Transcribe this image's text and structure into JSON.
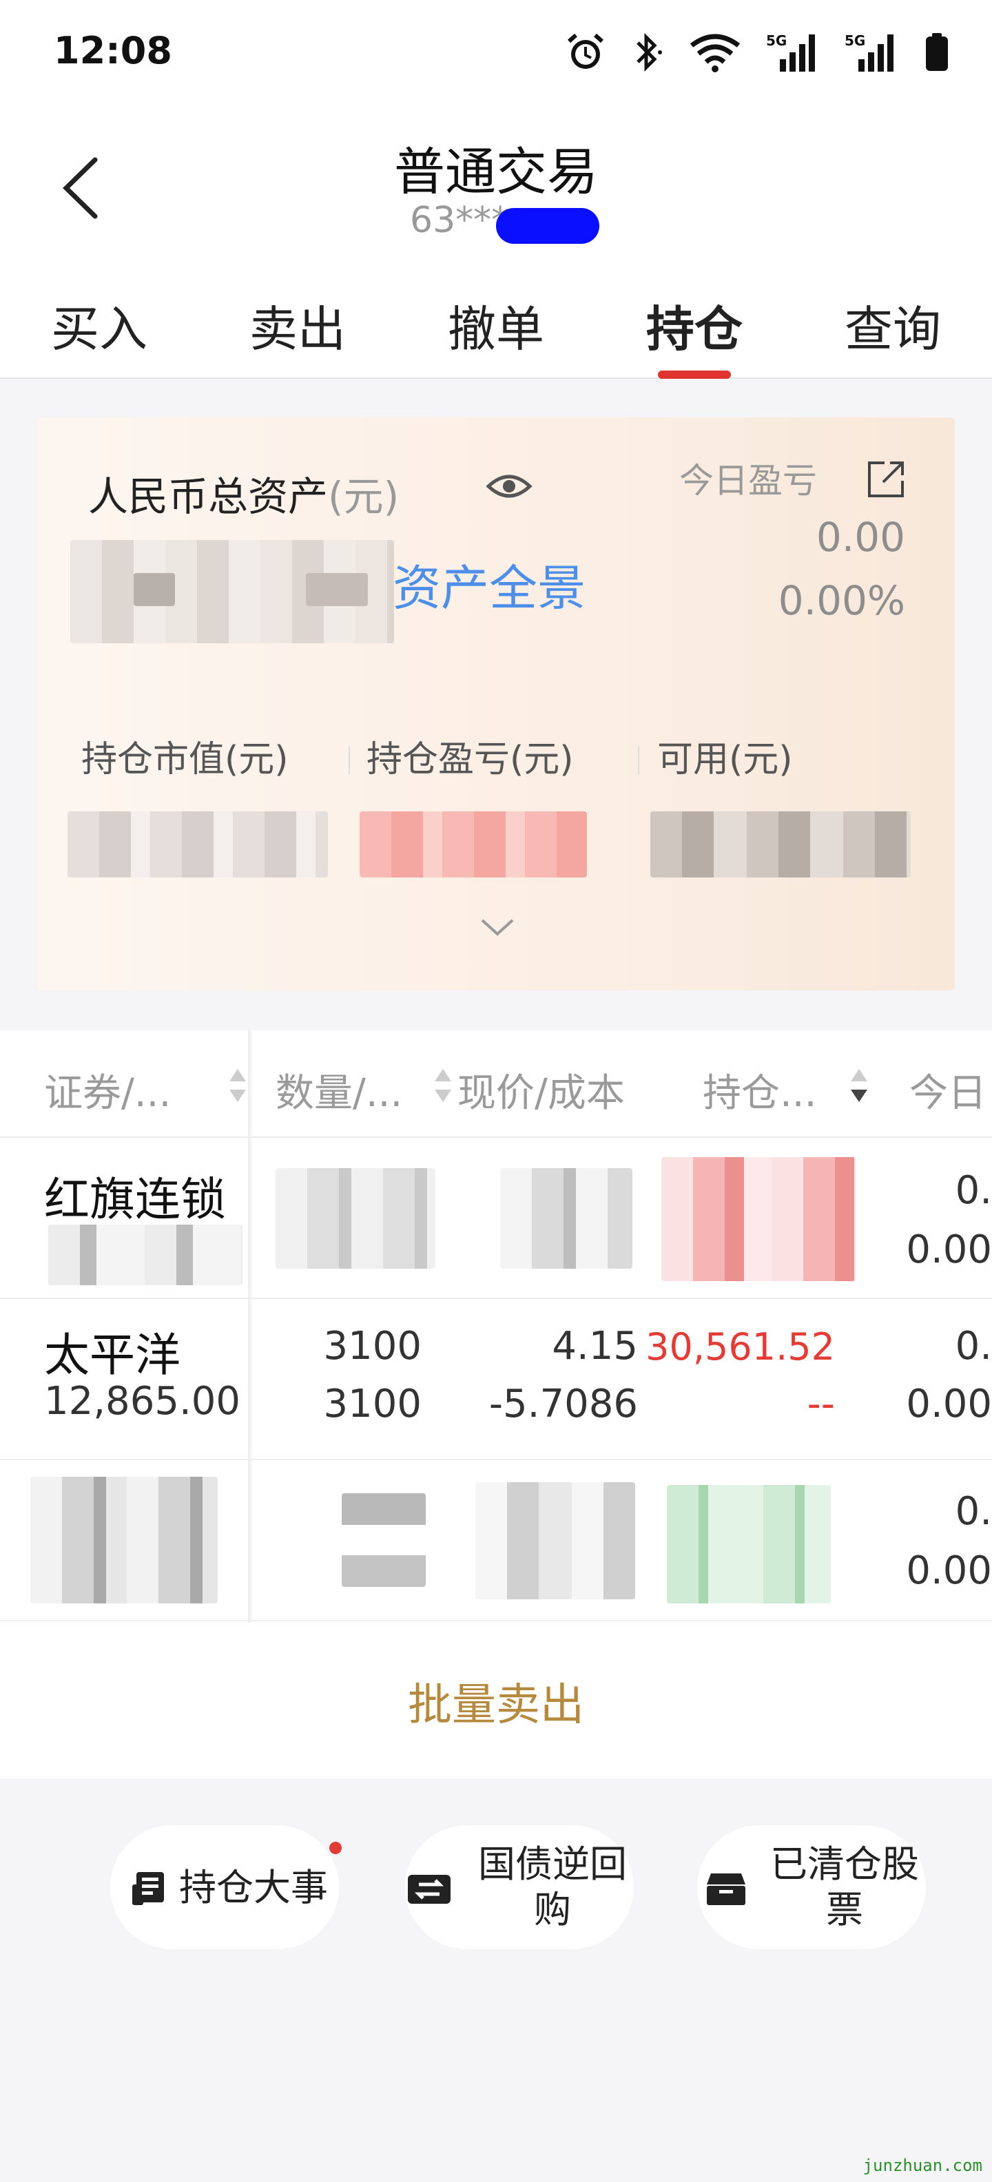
{
  "status_bar": {
    "time": "12:08",
    "network": "5G"
  },
  "header": {
    "title": "普通交易",
    "account": "63***"
  },
  "tabs": [
    "买入",
    "卖出",
    "撤单",
    "持仓",
    "查询"
  ],
  "active_tab": "持仓",
  "asset_card": {
    "total_label": "人民币总资产",
    "total_unit": "(元)",
    "overview_link": "资产全景",
    "today_pnl_label": "今日盈亏",
    "today_pnl_value": "0.00",
    "today_pnl_pct": "0.00%",
    "market_value_label": "持仓市值(元)",
    "position_pnl_label": "持仓盈亏(元)",
    "available_label": "可用(元)"
  },
  "table": {
    "headers": [
      "证券/...",
      "数量/...",
      "现价/成本",
      "持仓...",
      "今日"
    ],
    "rows": [
      {
        "name": "红旗连锁",
        "sub": "",
        "qty1": "",
        "qty2": "",
        "price": "",
        "cost": "",
        "pnl": "",
        "pnl2": "",
        "today1": "0.",
        "today2": "0.00"
      },
      {
        "name": "太平洋",
        "sub": "12,865.00",
        "qty1": "3100",
        "qty2": "3100",
        "price": "4.15",
        "cost": "-5.7086",
        "pnl": "30,561.52",
        "pnl2": "--",
        "today1": "0.",
        "today2": "0.00"
      },
      {
        "name": "",
        "sub": "",
        "qty1": "",
        "qty2": "",
        "price": "",
        "cost": "",
        "pnl": "",
        "pnl2": "",
        "today1": "0.",
        "today2": "0.00"
      }
    ]
  },
  "batch_sell": "批量卖出",
  "shortcuts": {
    "events": "持仓大事",
    "repo_line1": "国债逆回",
    "repo_line2": "购",
    "cleared_line1": "已清仓股",
    "cleared_line2": "票"
  },
  "watermark": "junzhuan.com",
  "colors": {
    "accent_red": "#e33b35",
    "link_blue": "#4d8fe8",
    "gold": "#b58a3f"
  }
}
